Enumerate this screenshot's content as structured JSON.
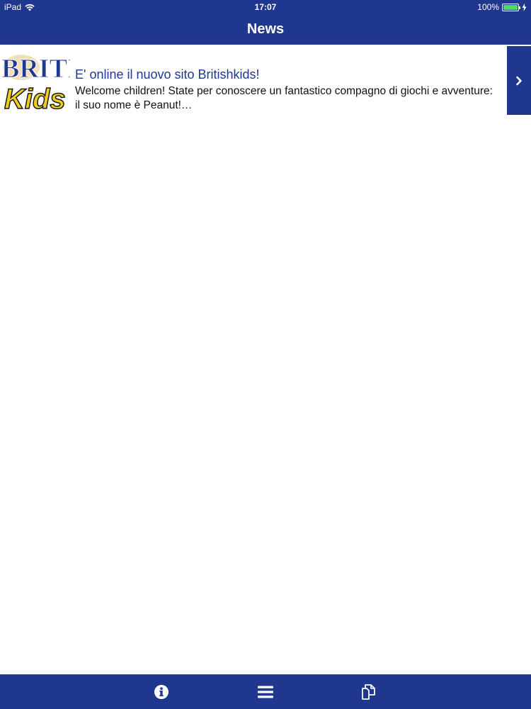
{
  "status": {
    "device": "iPad",
    "time": "17:07",
    "battery": "100%",
    "wifi_icon": "wifi-icon",
    "battery_level": 1.0
  },
  "nav": {
    "title": "News"
  },
  "news": [
    {
      "thumb_logo_line1": "BRITI",
      "thumb_logo_line2": "Kids",
      "title": "E' online il nuovo sito Britishkids!",
      "summary": "Welcome children! State per conoscere un fantastico compagno di giochi e avventure: il suo nome è Peanut!…",
      "action_icon": "chevron-right-icon"
    }
  ],
  "tabs": [
    {
      "icon": "info-icon"
    },
    {
      "icon": "menu-icon"
    },
    {
      "icon": "pages-icon"
    }
  ],
  "colors": {
    "brand": "#1f378f",
    "battery_green": "#4cd964",
    "logo_yellow": "#f2cc1b"
  }
}
